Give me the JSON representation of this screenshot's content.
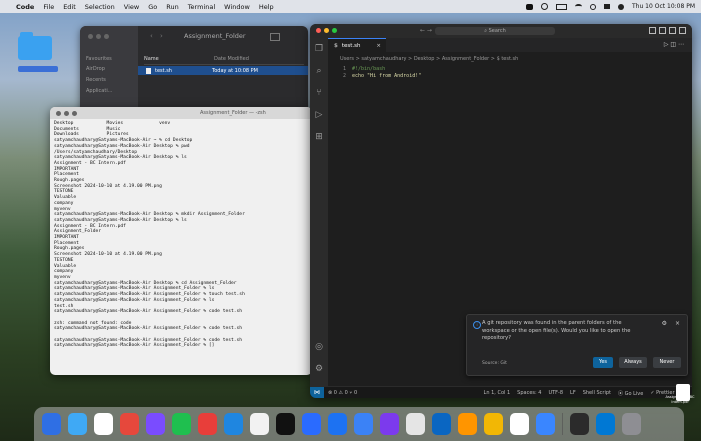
{
  "menubar": {
    "app_name": "Code",
    "items": [
      "File",
      "Edit",
      "Selection",
      "View",
      "Go",
      "Run",
      "Terminal",
      "Window",
      "Help"
    ],
    "clock": "Thu 10 Oct 10:08 PM"
  },
  "finder": {
    "title": "Assignment_Folder",
    "sidebar": [
      "Favourites",
      "AirDrop",
      "Recents",
      "Applicati..."
    ],
    "col_name": "Name",
    "col_date": "Date Modified",
    "file_name": "test.sh",
    "file_date": "Today at 10:08 PM"
  },
  "terminal": {
    "title": "Assignment_Folder — -zsh",
    "lines": [
      "Desktop            Movies             venv",
      "Documents          Music",
      "Downloads          Pictures",
      "satyamchaudhary@Satyams-MacBook-Air ~ % cd Desktop",
      "satyamchaudhary@Satyams-MacBook-Air Desktop % pwd",
      "/Users/satyamchaudhary/Desktop",
      "satyamchaudhary@Satyams-MacBook-Air Desktop % ls",
      "Assignment - BC Intern.pdf",
      "IMPORTANT",
      "Placement",
      "Rough.pages",
      "Screenshot 2024-10-10 at 4.19.00 PM.png",
      "TESTONE",
      "Valuable",
      "company",
      "myvenv",
      "satyamchaudhary@Satyams-MacBook-Air Desktop % mkdir Assignment_Folder",
      "satyamchaudhary@Satyams-MacBook-Air Desktop % ls",
      "Assignment - BC Intern.pdf",
      "Assignment_Folder",
      "IMPORTANT",
      "Placement",
      "Rough.pages",
      "Screenshot 2024-10-10 at 4.19.00 PM.png",
      "TESTONE",
      "Valuable",
      "company",
      "myvenv",
      "satyamchaudhary@Satyams-MacBook-Air Desktop % cd Assignment_Folder",
      "satyamchaudhary@Satyams-MacBook-Air Assignment_Folder % ls",
      "satyamchaudhary@Satyams-MacBook-Air Assignment_Folder % touch test.sh",
      "satyamchaudhary@Satyams-MacBook-Air Assignment_Folder % ls",
      "test.sh",
      "satyamchaudhary@Satyams-MacBook-Air Assignment_Folder % code test.sh",
      "",
      "zsh: command not found: code",
      "satyamchaudhary@Satyams-MacBook-Air Assignment_Folder % code test.sh",
      "",
      "satyamchaudhary@Satyams-MacBook-Air Assignment_Folder % code test.sh",
      "satyamchaudhary@Satyams-MacBook-Air Assignment_Folder % []"
    ]
  },
  "vscode": {
    "search_placeholder": "Search",
    "tab_name": "test.sh",
    "breadcrumb": "Users > satyamchaudhary > Desktop > Assignment_Folder > $ test.sh",
    "code": [
      {
        "num": "1",
        "text": "#!/bin/bash"
      },
      {
        "num": "2",
        "text": "echo \"Hi from Android!\""
      }
    ],
    "notification": {
      "message": "A git repository was found in the parent folders of the workspace or the open file(s). Would you like to open the repository?",
      "source": "Source: Git",
      "yes": "Yes",
      "always": "Always",
      "never": "Never"
    },
    "status_left": "⊗ 0 ⚠ 0   ⑂ 0",
    "status_right": [
      "Ln 1, Col 1",
      "Spaces: 4",
      "UTF-8",
      "LF",
      "Shell Script",
      "⦿ Go Live",
      "✓ Prettier"
    ]
  },
  "desktop": {
    "pdf_label": "Assignment - BC Intern.pdf"
  },
  "dock_colors": [
    "#2f6fe4",
    "#3fa9f5",
    "#ffffff",
    "#e6483c",
    "#7a4cff",
    "#1fbf4f",
    "#e83e3a",
    "#1f86e0",
    "#f2f2f2",
    "#111111",
    "#2a6bff",
    "#1d72f2",
    "#3b82f6",
    "#7c3aed",
    "#e5e5e5",
    "#0a66c2",
    "#ff9500",
    "#f2b705",
    "#ffffff",
    "#3a86ff",
    "#2b2b2b",
    "#0078d4",
    "#8e8e93"
  ]
}
